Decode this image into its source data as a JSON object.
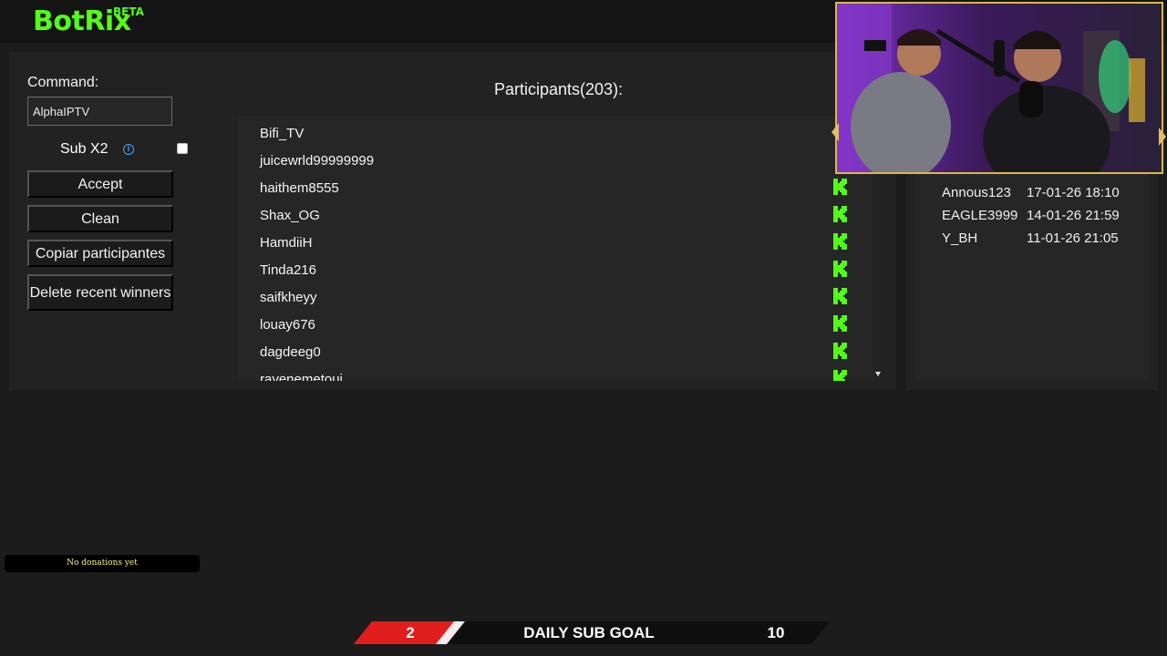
{
  "app": {
    "logo": "BotRix",
    "badge": "BETA",
    "accent_color": "#53fc18"
  },
  "controls": {
    "command_label": "Command:",
    "command_value": "AlphaIPTV",
    "sub_x2_label": "Sub X2",
    "sub_x2_checked": false,
    "info_icon": "info-icon",
    "accept_label": "Accept",
    "clean_label": "Clean",
    "copy_label": "Copiar participantes",
    "delete_label": "Delete recent winners"
  },
  "participants": {
    "title": "Participants(203):",
    "platform_icon": "kick-icon",
    "items": [
      {
        "name": "Bifi_TV"
      },
      {
        "name": "juicewrld99999999"
      },
      {
        "name": "haithem8555"
      },
      {
        "name": "Shax_OG"
      },
      {
        "name": "HamdiiH"
      },
      {
        "name": "Tinda216"
      },
      {
        "name": "saifkheyy"
      },
      {
        "name": "louay676"
      },
      {
        "name": "dagdeeg0"
      },
      {
        "name": "rayenemetoui"
      }
    ]
  },
  "winners": {
    "items": [
      {
        "name": "Annous123",
        "date": "17-01-26 18:10"
      },
      {
        "name": "EAGLE3999",
        "date": "14-01-26 21:59"
      },
      {
        "name": "Y_BH",
        "date": "11-01-26 21:05"
      }
    ]
  },
  "donations": {
    "text": "No donations yet"
  },
  "sub_goal": {
    "current": "2",
    "title": "DAILY SUB GOAL",
    "target": "10",
    "current_color": "#e01e1e"
  }
}
